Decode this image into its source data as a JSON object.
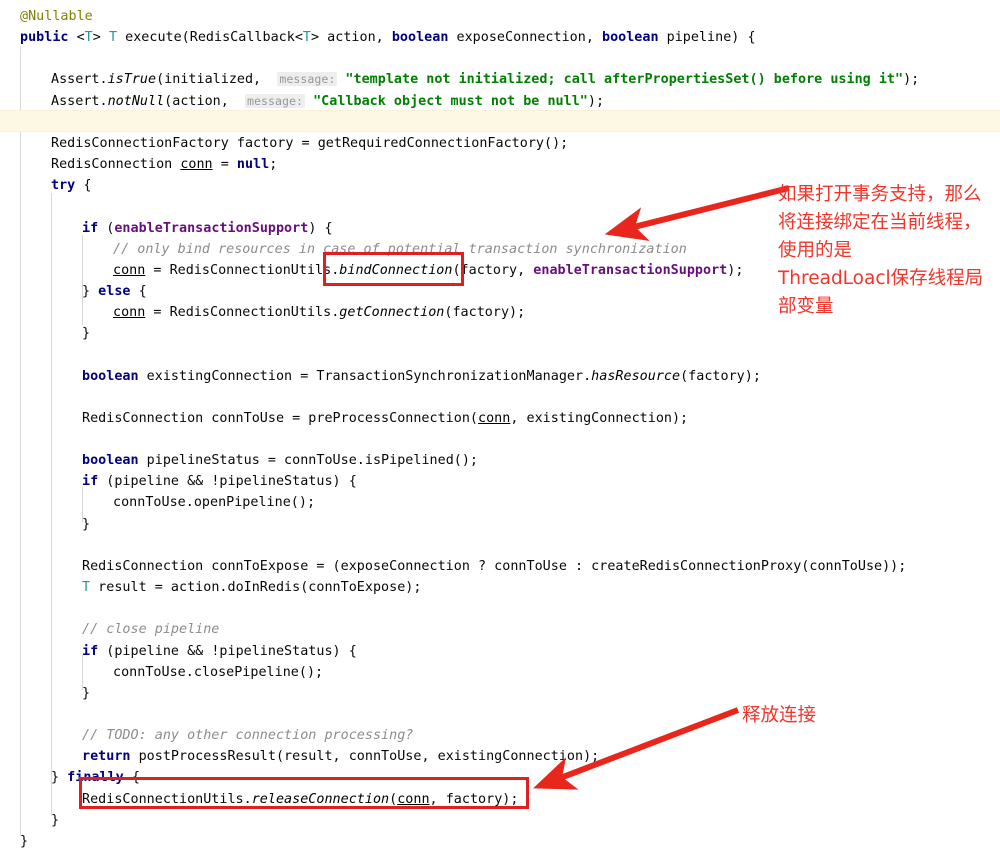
{
  "app": {
    "kind": "code-editor-source-view",
    "language": "Java",
    "method": "RedisTemplate.execute"
  },
  "theme": {
    "background": "#ffffff",
    "text": "#080808",
    "keyword": "#000080",
    "annotation": "#808000",
    "generic_type": "#20999d",
    "string": "#008000",
    "comment": "#8c8c8c",
    "field": "#660e7a",
    "param_hint_bg": "#eeeeee",
    "param_hint_text": "#999999",
    "current_line_highlight": "#fdf8e3",
    "indent_guide": "#d8d8d8",
    "marker_red": "#e02020",
    "note_red": "#f0352b"
  },
  "code": {
    "lines": [
      {
        "n": 1,
        "indent": 0,
        "tokens": [
          {
            "t": "@Nullable",
            "c": "anno"
          }
        ]
      },
      {
        "n": 2,
        "indent": 0,
        "tokens": [
          {
            "t": "public ",
            "c": "kw"
          },
          {
            "t": "<",
            "c": "plain"
          },
          {
            "t": "T",
            "c": "type-t"
          },
          {
            "t": "> ",
            "c": "plain"
          },
          {
            "t": "T",
            "c": "type-t"
          },
          {
            "t": " execute(RedisCallback<",
            "c": "plain"
          },
          {
            "t": "T",
            "c": "type-t"
          },
          {
            "t": "> action, ",
            "c": "plain"
          },
          {
            "t": "boolean",
            "c": "kw"
          },
          {
            "t": " exposeConnection, ",
            "c": "plain"
          },
          {
            "t": "boolean",
            "c": "kw"
          },
          {
            "t": " pipeline) {",
            "c": "plain"
          }
        ]
      },
      {
        "n": 3,
        "indent": 0,
        "tokens": []
      },
      {
        "n": 4,
        "indent": 1,
        "tokens": [
          {
            "t": "Assert.",
            "c": "plain"
          },
          {
            "t": "isTrue",
            "c": "mth"
          },
          {
            "t": "(initialized,  ",
            "c": "plain"
          },
          {
            "t": "message:",
            "c": "hint"
          },
          {
            "t": " ",
            "c": "plain"
          },
          {
            "t": "\"template not initialized; call afterPropertiesSet() before using it\"",
            "c": "str"
          },
          {
            "t": ");",
            "c": "plain"
          }
        ]
      },
      {
        "n": 5,
        "indent": 1,
        "tokens": [
          {
            "t": "Assert.",
            "c": "plain"
          },
          {
            "t": "notNull",
            "c": "mth"
          },
          {
            "t": "(action,  ",
            "c": "plain"
          },
          {
            "t": "message:",
            "c": "hint"
          },
          {
            "t": " ",
            "c": "plain"
          },
          {
            "t": "\"Callback object must not be null\"",
            "c": "str"
          },
          {
            "t": ");",
            "c": "plain"
          }
        ]
      },
      {
        "n": 6,
        "indent": 0,
        "tokens": []
      },
      {
        "n": 7,
        "indent": 1,
        "tokens": [
          {
            "t": "RedisConnectionFactory factory = getRequiredConnectionFactory();",
            "c": "plain"
          }
        ]
      },
      {
        "n": 8,
        "indent": 1,
        "tokens": [
          {
            "t": "RedisConnection ",
            "c": "plain"
          },
          {
            "t": "conn",
            "c": "loc"
          },
          {
            "t": " = ",
            "c": "plain"
          },
          {
            "t": "null",
            "c": "kw"
          },
          {
            "t": ";",
            "c": "plain"
          }
        ]
      },
      {
        "n": 9,
        "indent": 1,
        "tokens": [
          {
            "t": "try",
            "c": "kw"
          },
          {
            "t": " {",
            "c": "plain"
          }
        ]
      },
      {
        "n": 10,
        "indent": 0,
        "tokens": []
      },
      {
        "n": 11,
        "indent": 2,
        "tokens": [
          {
            "t": "if",
            "c": "kw"
          },
          {
            "t": " (",
            "c": "plain"
          },
          {
            "t": "enableTransactionSupport",
            "c": "fld"
          },
          {
            "t": ") {",
            "c": "plain"
          }
        ]
      },
      {
        "n": 12,
        "indent": 3,
        "tokens": [
          {
            "t": "// only bind resources in case of potential transaction synchronization",
            "c": "cmt"
          }
        ]
      },
      {
        "n": 13,
        "indent": 3,
        "tokens": [
          {
            "t": "conn",
            "c": "loc"
          },
          {
            "t": " = RedisConnectionUtils.",
            "c": "plain"
          },
          {
            "t": "bindConnection",
            "c": "mth"
          },
          {
            "t": "(factory, ",
            "c": "plain"
          },
          {
            "t": "enableTransactionSupport",
            "c": "fld"
          },
          {
            "t": ");",
            "c": "plain"
          }
        ]
      },
      {
        "n": 14,
        "indent": 2,
        "tokens": [
          {
            "t": "} ",
            "c": "plain"
          },
          {
            "t": "else",
            "c": "kw"
          },
          {
            "t": " {",
            "c": "plain"
          }
        ]
      },
      {
        "n": 15,
        "indent": 3,
        "tokens": [
          {
            "t": "conn",
            "c": "loc"
          },
          {
            "t": " = RedisConnectionUtils.",
            "c": "plain"
          },
          {
            "t": "getConnection",
            "c": "mth"
          },
          {
            "t": "(factory);",
            "c": "plain"
          }
        ]
      },
      {
        "n": 16,
        "indent": 2,
        "tokens": [
          {
            "t": "}",
            "c": "plain"
          }
        ]
      },
      {
        "n": 17,
        "indent": 0,
        "tokens": []
      },
      {
        "n": 18,
        "indent": 2,
        "tokens": [
          {
            "t": "boolean",
            "c": "kw"
          },
          {
            "t": " existingConnection = TransactionSynchronizationManager.",
            "c": "plain"
          },
          {
            "t": "hasResource",
            "c": "mth"
          },
          {
            "t": "(factory);",
            "c": "plain"
          }
        ]
      },
      {
        "n": 19,
        "indent": 0,
        "tokens": []
      },
      {
        "n": 20,
        "indent": 2,
        "tokens": [
          {
            "t": "RedisConnection connToUse = preProcessConnection(",
            "c": "plain"
          },
          {
            "t": "conn",
            "c": "loc"
          },
          {
            "t": ", existingConnection);",
            "c": "plain"
          }
        ]
      },
      {
        "n": 21,
        "indent": 0,
        "tokens": []
      },
      {
        "n": 22,
        "indent": 2,
        "tokens": [
          {
            "t": "boolean",
            "c": "kw"
          },
          {
            "t": " pipelineStatus = connToUse.isPipelined();",
            "c": "plain"
          }
        ]
      },
      {
        "n": 23,
        "indent": 2,
        "tokens": [
          {
            "t": "if",
            "c": "kw"
          },
          {
            "t": " (pipeline && !pipelineStatus) {",
            "c": "plain"
          }
        ]
      },
      {
        "n": 24,
        "indent": 3,
        "tokens": [
          {
            "t": "connToUse.openPipeline();",
            "c": "plain"
          }
        ]
      },
      {
        "n": 25,
        "indent": 2,
        "tokens": [
          {
            "t": "}",
            "c": "plain"
          }
        ]
      },
      {
        "n": 26,
        "indent": 0,
        "tokens": []
      },
      {
        "n": 27,
        "indent": 2,
        "tokens": [
          {
            "t": "RedisConnection connToExpose = (exposeConnection ? connToUse : createRedisConnectionProxy(connToUse));",
            "c": "plain"
          }
        ]
      },
      {
        "n": 28,
        "indent": 2,
        "tokens": [
          {
            "t": "T",
            "c": "type-t"
          },
          {
            "t": " result = action.doInRedis(connToExpose);",
            "c": "plain"
          }
        ]
      },
      {
        "n": 29,
        "indent": 0,
        "tokens": []
      },
      {
        "n": 30,
        "indent": 2,
        "tokens": [
          {
            "t": "// close pipeline",
            "c": "cmt"
          }
        ]
      },
      {
        "n": 31,
        "indent": 2,
        "tokens": [
          {
            "t": "if",
            "c": "kw"
          },
          {
            "t": " (pipeline && !pipelineStatus) {",
            "c": "plain"
          }
        ]
      },
      {
        "n": 32,
        "indent": 3,
        "tokens": [
          {
            "t": "connToUse.closePipeline();",
            "c": "plain"
          }
        ]
      },
      {
        "n": 33,
        "indent": 2,
        "tokens": [
          {
            "t": "}",
            "c": "plain"
          }
        ]
      },
      {
        "n": 34,
        "indent": 0,
        "tokens": []
      },
      {
        "n": 35,
        "indent": 2,
        "tokens": [
          {
            "t": "// TODO: any other connection processing?",
            "c": "cmt"
          }
        ]
      },
      {
        "n": 36,
        "indent": 2,
        "tokens": [
          {
            "t": "return",
            "c": "kw"
          },
          {
            "t": " postProcessResult(result, connToUse, existingConnection);",
            "c": "plain"
          }
        ]
      },
      {
        "n": 37,
        "indent": 1,
        "tokens": [
          {
            "t": "} ",
            "c": "plain"
          },
          {
            "t": "finally",
            "c": "kw"
          },
          {
            "t": " {",
            "c": "plain"
          }
        ]
      },
      {
        "n": 38,
        "indent": 2,
        "tokens": [
          {
            "t": "RedisConnectionUtils.",
            "c": "plain"
          },
          {
            "t": "releaseConnection",
            "c": "mth"
          },
          {
            "t": "(",
            "c": "plain"
          },
          {
            "t": "conn",
            "c": "loc"
          },
          {
            "t": ", factory);",
            "c": "plain"
          }
        ]
      },
      {
        "n": 39,
        "indent": 1,
        "tokens": [
          {
            "t": "}",
            "c": "plain"
          }
        ]
      },
      {
        "n": 40,
        "indent": 0,
        "tokens": [
          {
            "t": "}",
            "c": "plain"
          }
        ]
      }
    ]
  },
  "annotations": {
    "highlight_boxes": [
      {
        "id": "bind-connection-box",
        "label": ".bindConnection("
      },
      {
        "id": "release-connection-box",
        "label": "RedisConnectionUtils.releaseConnection(conn, factory);"
      }
    ],
    "notes": [
      {
        "id": "transaction-note",
        "text": "如果打开事务支持，那么将连接绑定在当前线程，使用的是\nThreadLoacl保存线程局部变量"
      },
      {
        "id": "release-note",
        "text": "释放连接"
      }
    ],
    "arrows": [
      {
        "id": "transaction-arrow",
        "points_to": "bind-connection-box"
      },
      {
        "id": "release-arrow",
        "points_to": "release-connection-box"
      }
    ]
  }
}
